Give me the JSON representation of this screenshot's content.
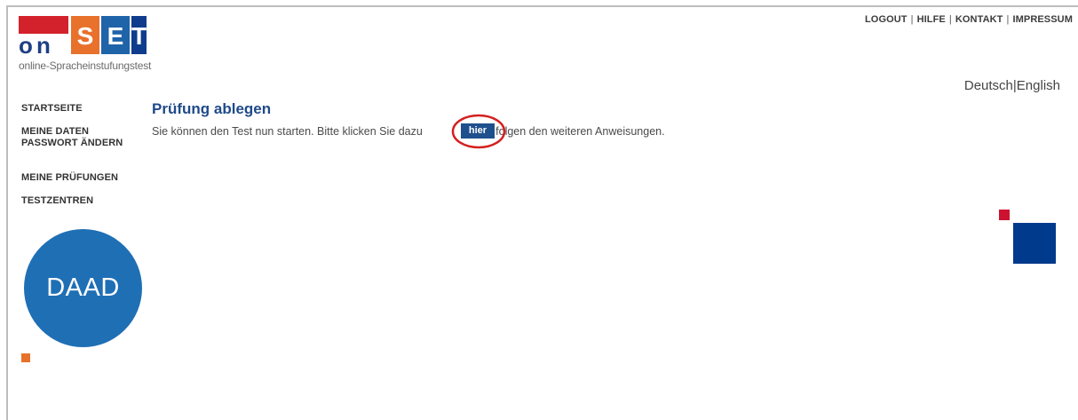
{
  "logo": {
    "letters": [
      "o",
      "n",
      "S",
      "E",
      "T"
    ],
    "tagline": "online-Spracheinstufungstest",
    "colors": {
      "red": "#d3222b",
      "orange": "#e8712b",
      "blue": "#1f63a9",
      "navy": "#0f3c8c"
    }
  },
  "topnav": {
    "items": [
      "LOGOUT",
      "HILFE",
      "KONTAKT",
      "IMPRESSUM"
    ],
    "separator": "|"
  },
  "language": {
    "de": "Deutsch",
    "separator": "|",
    "en": "English"
  },
  "sidebar": {
    "items": [
      {
        "label": "STARTSEITE"
      },
      {
        "label": "MEINE DATEN"
      },
      {
        "label": "PASSWORT ÄNDERN"
      },
      {
        "label": "MEINE PRÜFUNGEN"
      },
      {
        "label": "TESTZENTREN"
      }
    ]
  },
  "daad": {
    "label": "DAAD",
    "color": "#1f6fb5"
  },
  "main": {
    "title": "Prüfung ablegen",
    "text_before": "Sie können den Test nun starten. Bitte klicken Sie dazu",
    "button_label": "hier",
    "text_after": "und folgen den weiteren Anweisungen."
  },
  "annotation": {
    "color": "#d42020",
    "icon": "red-circle-highlight"
  }
}
